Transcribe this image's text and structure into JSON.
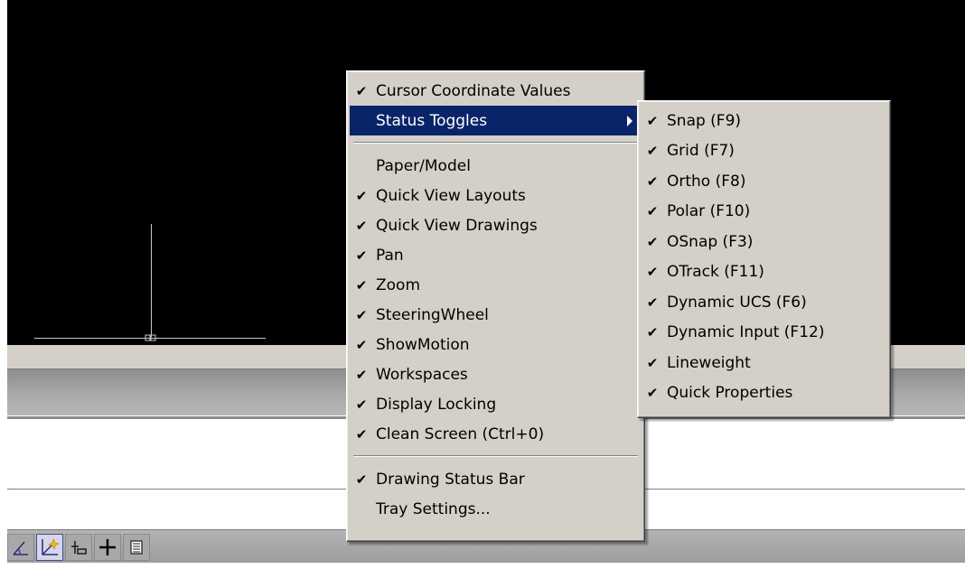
{
  "main_menu": {
    "items": [
      {
        "label": "Cursor Coordinate Values",
        "checked": "✔"
      },
      {
        "label": "Status Toggles",
        "checked": "",
        "submenu": true,
        "highlighted": true
      },
      {
        "label": "Paper/Model",
        "checked": ""
      },
      {
        "label": "Quick View Layouts",
        "checked": "✔"
      },
      {
        "label": "Quick View Drawings",
        "checked": "✔"
      },
      {
        "label": "Pan",
        "checked": "✔"
      },
      {
        "label": "Zoom",
        "checked": "✔"
      },
      {
        "label": "SteeringWheel",
        "checked": "✔"
      },
      {
        "label": "ShowMotion",
        "checked": "✔"
      },
      {
        "label": "Workspaces",
        "checked": "✔"
      },
      {
        "label": "Display Locking",
        "checked": "✔"
      },
      {
        "label": "Clean Screen (Ctrl+0)",
        "checked": "✔"
      },
      {
        "label": "Drawing Status Bar",
        "checked": "✔"
      },
      {
        "label": "Tray Settings...",
        "checked": ""
      }
    ]
  },
  "submenu": {
    "items": [
      {
        "label": "Snap (F9)",
        "checked": "✔"
      },
      {
        "label": "Grid (F7)",
        "checked": "✔"
      },
      {
        "label": "Ortho (F8)",
        "checked": "✔"
      },
      {
        "label": "Polar (F10)",
        "checked": "✔"
      },
      {
        "label": "OSnap (F3)",
        "checked": "✔"
      },
      {
        "label": "OTrack (F11)",
        "checked": "✔"
      },
      {
        "label": "Dynamic UCS (F6)",
        "checked": "✔"
      },
      {
        "label": "Dynamic Input (F12)",
        "checked": "✔"
      },
      {
        "label": "Lineweight",
        "checked": "✔"
      },
      {
        "label": "Quick Properties",
        "checked": "✔"
      }
    ]
  },
  "status_bar": {
    "buttons": [
      {
        "icon": "dynamic-ucs-icon"
      },
      {
        "icon": "dynamic-input-icon",
        "active": true
      },
      {
        "icon": "lineweight-icon"
      },
      {
        "icon": "crosshair-icon"
      },
      {
        "icon": "quick-properties-icon"
      }
    ]
  },
  "colors": {
    "menu_bg": "#d4d0c8",
    "highlight": "#0a246a",
    "canvas": "#000000"
  }
}
